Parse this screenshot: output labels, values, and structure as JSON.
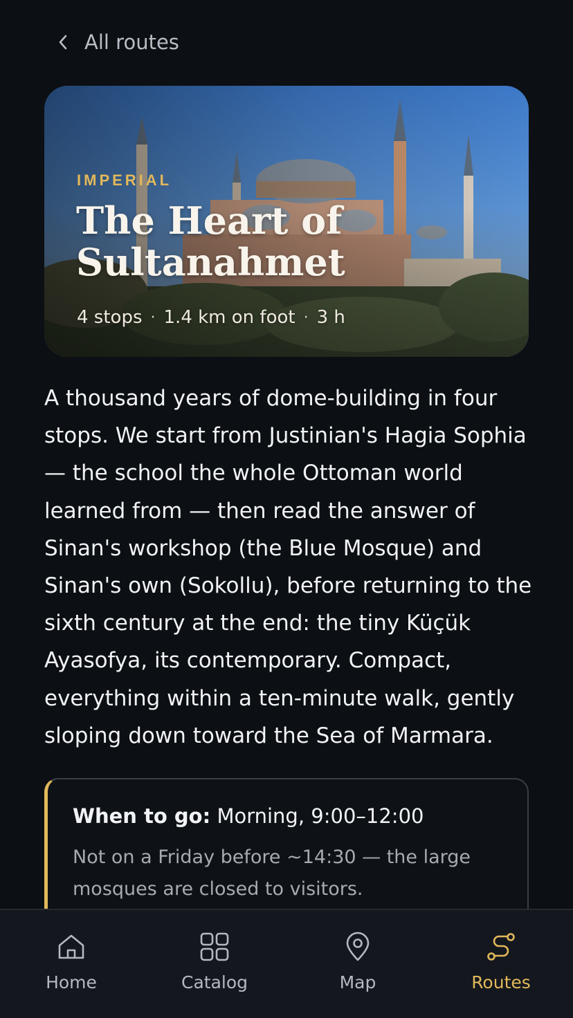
{
  "nav": {
    "back_label": "All routes"
  },
  "hero": {
    "eyebrow": "IMPERIAL",
    "title": "The Heart of Sultanahmet",
    "stops": "4 stops",
    "distance": "1.4 km on foot",
    "duration": "3 h",
    "separator": "·"
  },
  "description": "A thousand years of dome-building in four stops. We start from Justinian's Hagia Sophia — the school the whole Ottoman world learned from — then read the answer of Sinan's workshop (the Blue Mosque) and Sinan's own (Sokollu), before returning to the sixth century at the end: the tiny Küçük Ayasofya, its contemporary. Compact, everything within a ten-minute walk, gently sloping down toward the Sea of Marmara.",
  "when": {
    "label": "When to go:",
    "value": "Morning, 9:00–12:00",
    "note": "Not on a Friday before ~14:30 — the large mosques are closed to visitors."
  },
  "tabs": [
    {
      "label": "Home",
      "icon": "home-icon",
      "active": false
    },
    {
      "label": "Catalog",
      "icon": "grid-icon",
      "active": false
    },
    {
      "label": "Map",
      "icon": "map-pin-icon",
      "active": false
    },
    {
      "label": "Routes",
      "icon": "route-icon",
      "active": true
    }
  ],
  "colors": {
    "accent": "#e2b85a",
    "background": "#0c0f13",
    "tabbar": "#14181e"
  }
}
